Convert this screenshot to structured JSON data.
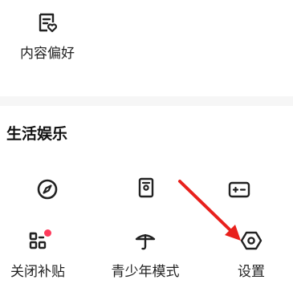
{
  "preferences": {
    "content_pref": {
      "label": "内容偏好",
      "icon": "content-preference-icon"
    }
  },
  "life_section": {
    "title": "生活娱乐",
    "row1": [
      {
        "label": "",
        "icon": "compass-icon"
      },
      {
        "label": "",
        "icon": "id-card-icon"
      },
      {
        "label": "",
        "icon": "game-controller-icon"
      }
    ],
    "row2": [
      {
        "label": "关闭补贴",
        "icon": "grid-apps-icon",
        "badge": true
      },
      {
        "label": "青少年模式",
        "icon": "umbrella-icon"
      },
      {
        "label": "设置",
        "icon": "settings-hexagon-icon"
      }
    ]
  },
  "annotation": {
    "arrow_color": "#e8201c"
  }
}
